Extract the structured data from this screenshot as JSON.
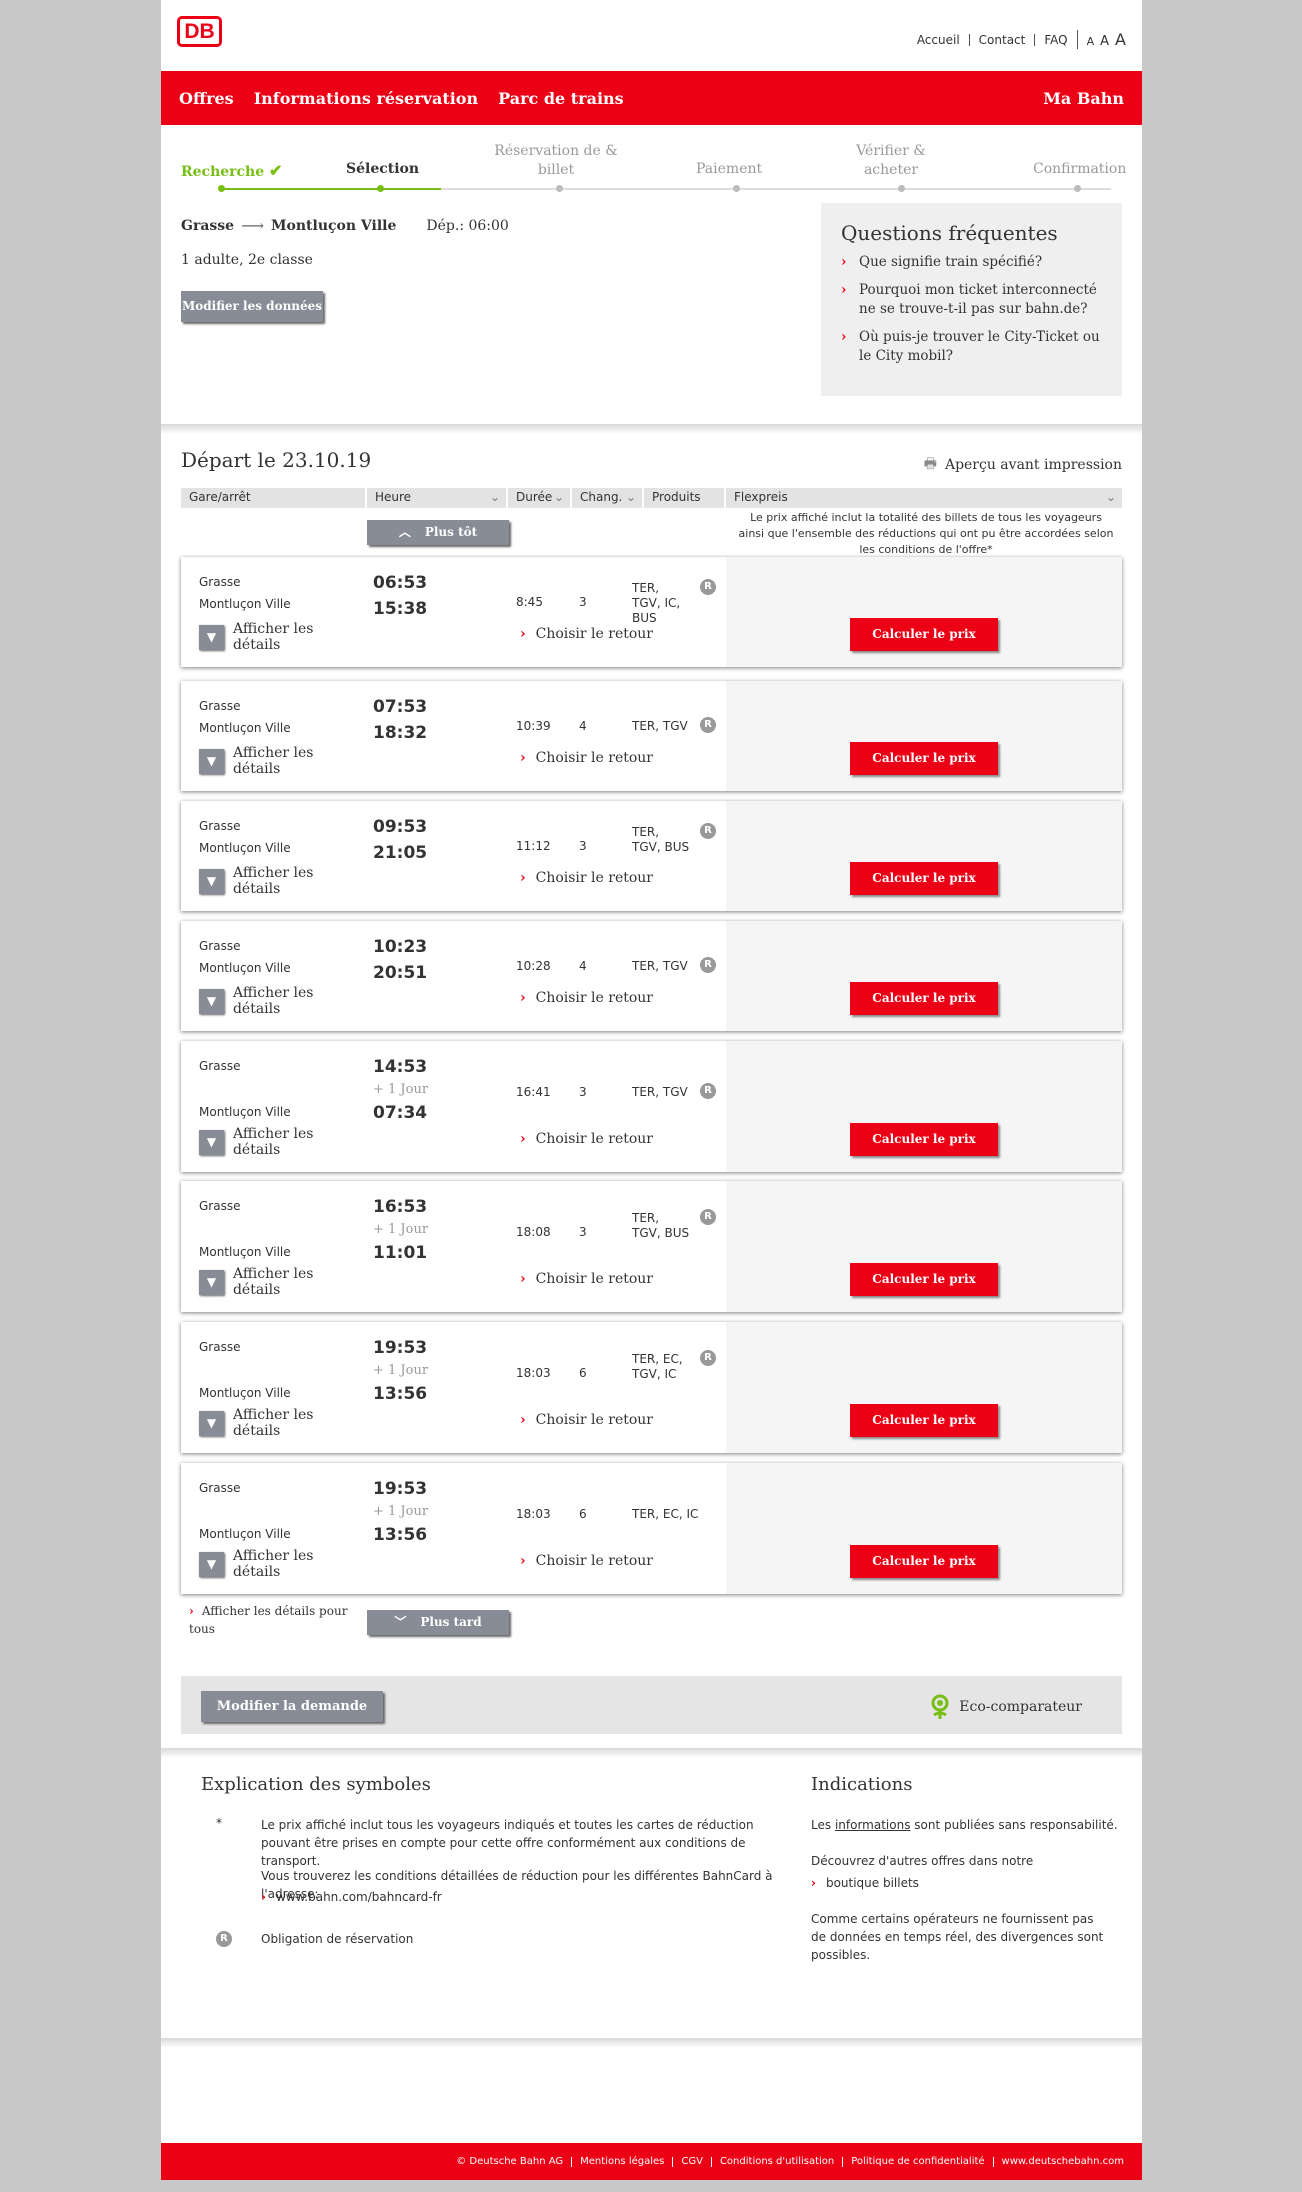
{
  "header": {
    "logo": "DB",
    "links": [
      "Accueil",
      "Contact",
      "FAQ"
    ],
    "font_sizes": [
      "A",
      "A",
      "A"
    ]
  },
  "nav": {
    "items": [
      "Offres",
      "Informations réservation",
      "Parc de trains"
    ],
    "account": "Ma Bahn"
  },
  "steps": [
    {
      "label": "Recherche",
      "state": "done"
    },
    {
      "label": "Sélection",
      "state": "active"
    },
    {
      "label": "Réservation de & billet",
      "state": "todo"
    },
    {
      "label": "Paiement",
      "state": "todo"
    },
    {
      "label": "Vérifier & acheter",
      "state": "todo"
    },
    {
      "label": "Confirmation",
      "state": "todo"
    }
  ],
  "search": {
    "from": "Grasse",
    "to": "Montluçon Ville",
    "dep": "Dép.: 06:00",
    "travellers": "1 adulte, 2e classe",
    "modify": "Modifier les données"
  },
  "faq": {
    "title": "Questions fréquentes",
    "items": [
      "Que signifie train spécifié?",
      "Pourquoi mon ticket interconnecté ne se trouve-t-il pas sur bahn.de?",
      "Où puis-je trouver le City-Ticket ou le City mobil?"
    ]
  },
  "results": {
    "title": "Départ le 23.10.19",
    "print": "Aperçu avant impression",
    "columns": [
      "Gare/arrêt",
      "Heure",
      "Durée",
      "Chang.",
      "Produits",
      "Flexpreis"
    ],
    "earlier": "Plus tôt",
    "later": "Plus tard",
    "price_note": "Le prix affiché inclut la totalité des billets de tous les voyageurs ainsi que l'ensemble des réductions qui ont pu être accordées selon les conditions de l'offre*",
    "show_all": "Afficher les détails pour tous",
    "details_label": "Afficher les détails",
    "return_label": "Choisir le retour",
    "calc_label": "Calculer le prix",
    "plus_day": "+ 1 Jour",
    "connections": [
      {
        "from": "Grasse",
        "to": "Montluçon Ville",
        "dep": "06:53",
        "arr": "15:38",
        "next_day": false,
        "duration": "8:45",
        "changes": "3",
        "products": [
          "TER,",
          "TGV, IC,",
          "BUS"
        ],
        "reservation": true
      },
      {
        "from": "Grasse",
        "to": "Montluçon Ville",
        "dep": "07:53",
        "arr": "18:32",
        "next_day": false,
        "duration": "10:39",
        "changes": "4",
        "products": [
          "TER, TGV"
        ],
        "reservation": true
      },
      {
        "from": "Grasse",
        "to": "Montluçon Ville",
        "dep": "09:53",
        "arr": "21:05",
        "next_day": false,
        "duration": "11:12",
        "changes": "3",
        "products": [
          "TER,",
          "TGV, BUS"
        ],
        "reservation": true
      },
      {
        "from": "Grasse",
        "to": "Montluçon Ville",
        "dep": "10:23",
        "arr": "20:51",
        "next_day": false,
        "duration": "10:28",
        "changes": "4",
        "products": [
          "TER, TGV"
        ],
        "reservation": true
      },
      {
        "from": "Grasse",
        "to": "Montluçon Ville",
        "dep": "14:53",
        "arr": "07:34",
        "next_day": true,
        "duration": "16:41",
        "changes": "3",
        "products": [
          "TER, TGV"
        ],
        "reservation": true
      },
      {
        "from": "Grasse",
        "to": "Montluçon Ville",
        "dep": "16:53",
        "arr": "11:01",
        "next_day": true,
        "duration": "18:08",
        "changes": "3",
        "products": [
          "TER,",
          "TGV, BUS"
        ],
        "reservation": true
      },
      {
        "from": "Grasse",
        "to": "Montluçon Ville",
        "dep": "19:53",
        "arr": "13:56",
        "next_day": true,
        "duration": "18:03",
        "changes": "6",
        "products": [
          "TER, EC,",
          "TGV, IC"
        ],
        "reservation": true
      },
      {
        "from": "Grasse",
        "to": "Montluçon Ville",
        "dep": "19:53",
        "arr": "13:56",
        "next_day": true,
        "duration": "18:03",
        "changes": "6",
        "products": [
          "TER, EC, IC"
        ],
        "reservation": false
      }
    ]
  },
  "bottom": {
    "modify": "Modifier la demande",
    "eco": "Eco-comparateur"
  },
  "symbols": {
    "title": "Explication des symboles",
    "star": "*",
    "star_text": "Le prix affiché inclut tous les voyageurs indiqués et toutes les cartes de réduction pouvant être prises en compte pour cette offre conformément aux conditions de transport.",
    "bahncard_text": "Vous trouverez les conditions détaillées de réduction pour les différentes BahnCard à l'adresse:",
    "bahncard_link": "www.bahn.com/bahncard-fr",
    "r_badge": "R",
    "r_text": "Obligation de réservation"
  },
  "indications": {
    "title": "Indications",
    "line1_pre": "Les ",
    "line1_link": "informations",
    "line1_post": " sont publiées sans responsabilité.",
    "line2": "Découvrez d'autres offres dans notre",
    "line2_link": "boutique billets",
    "line3": "Comme certains opérateurs ne fournissent pas de données en temps réel, des divergences sont possibles."
  },
  "footer": [
    "© Deutsche Bahn AG",
    "Mentions légales",
    "CGV",
    "Conditions d'utilisation",
    "Politique de confidentialité",
    "www.deutschebahn.com"
  ],
  "colors": {
    "brand_red": "#ec0016",
    "done_green": "#78be14",
    "button_grey": "#878c96"
  }
}
